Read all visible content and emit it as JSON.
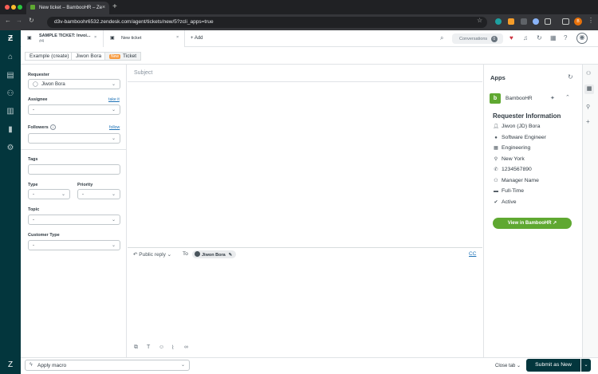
{
  "browser": {
    "tab_title": "New ticket – BambooHR – Ze",
    "url": "d3v-bamboohr6532.zendesk.com/agent/tickets/new/5?zcli_apps=true"
  },
  "header": {
    "tabs": [
      {
        "title": "SAMPLE TICKET: Invoi...",
        "subtitle": "#4"
      },
      {
        "title": "New ticket"
      }
    ],
    "add_label": "Add",
    "conversations_label": "Conversations",
    "conversations_count": "0"
  },
  "breadcrumb": {
    "items": [
      "Example (create)",
      "Jiwon Bora"
    ],
    "status_badge": "New",
    "ticket_label": "Ticket"
  },
  "properties": {
    "requester_label": "Requester",
    "requester_value": "Jiwon Bora",
    "assignee_label": "Assignee",
    "assignee_link": "take it",
    "assignee_value": "-",
    "followers_label": "Followers",
    "followers_link": "follow",
    "tags_label": "Tags",
    "type_label": "Type",
    "type_value": "-",
    "priority_label": "Priority",
    "priority_value": "-",
    "topic_label": "Topic",
    "topic_value": "-",
    "customer_type_label": "Customer Type",
    "customer_type_value": "-"
  },
  "editor": {
    "subject_placeholder": "Subject",
    "reply_mode": "Public reply",
    "to_label": "To",
    "to_recipient": "Jiwon Bora",
    "cc_label": "CC"
  },
  "apps": {
    "title": "Apps",
    "app_name": "BambooHR",
    "section_title": "Requester Information",
    "rows": [
      {
        "icon": "person-icon",
        "text": "Jiwon (JD) Bora"
      },
      {
        "icon": "circle-icon",
        "text": "Software Engineer"
      },
      {
        "icon": "building-icon",
        "text": "Engineering"
      },
      {
        "icon": "pin-icon",
        "text": "New York"
      },
      {
        "icon": "phone-icon",
        "text": "1234567890"
      },
      {
        "icon": "people-icon",
        "text": "Manager Name"
      },
      {
        "icon": "briefcase-icon",
        "text": "Full-Time"
      },
      {
        "icon": "check-icon",
        "text": "Active"
      }
    ],
    "view_button": "View in BambooHR"
  },
  "footer": {
    "macro_label": "Apply macro",
    "close_tab_label": "Close tab",
    "submit_label": "Submit as New"
  },
  "colors": {
    "nav_bg": "#03363d",
    "bamboo_green": "#5fa831",
    "link_blue": "#1f73b7",
    "new_badge": "#f79a3e"
  }
}
